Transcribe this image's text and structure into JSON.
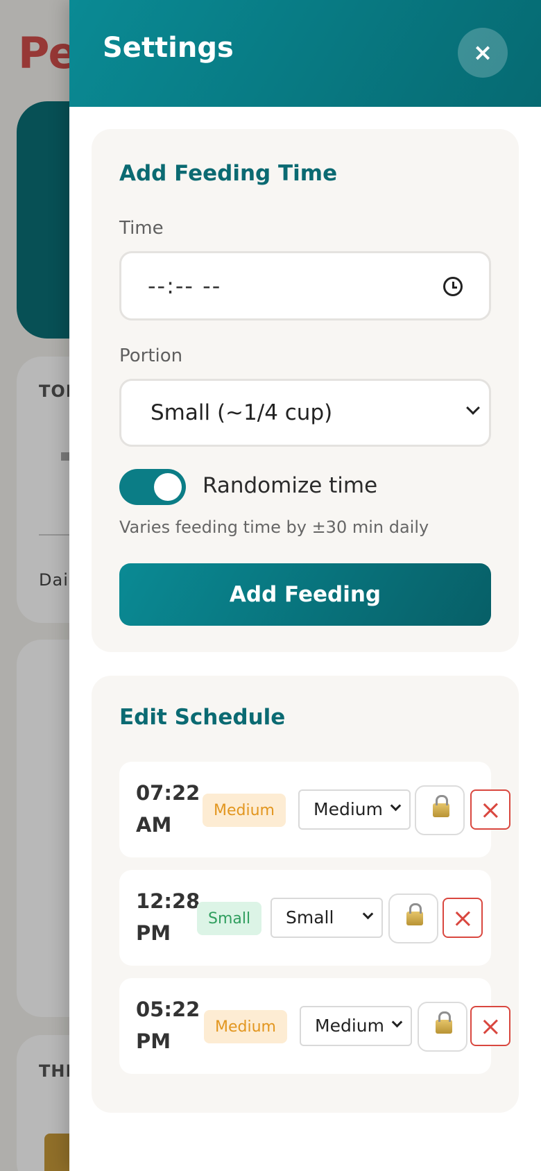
{
  "background": {
    "logo_fragment": "Pe",
    "card1_label": "TOD",
    "card1_footer": "Dail",
    "card3_label": "THI"
  },
  "panel": {
    "title": "Settings",
    "close_label": "×"
  },
  "add_feeding": {
    "title": "Add Feeding Time",
    "time_label": "Time",
    "time_value": "--:-- --",
    "portion_label": "Portion",
    "portion_value": "Small (~1/4 cup)",
    "randomize_label": "Randomize time",
    "randomize_on": true,
    "hint": "Varies feeding time by ±30 min daily",
    "button_label": "Add Feeding"
  },
  "edit_schedule": {
    "title": "Edit Schedule",
    "rows": [
      {
        "time_line1": "07:22",
        "time_line2": "AM",
        "badge": "Medium",
        "portion": "Medium"
      },
      {
        "time_line1": "12:28",
        "time_line2": "PM",
        "badge": "Small",
        "portion": "Small"
      },
      {
        "time_line1": "05:22",
        "time_line2": "PM",
        "badge": "Medium",
        "portion": "Medium"
      }
    ]
  },
  "colors": {
    "brand_teal": "#0b7d86",
    "danger": "#d9473f",
    "medium_badge": "#e2961f",
    "small_badge": "#2f9e5e"
  }
}
